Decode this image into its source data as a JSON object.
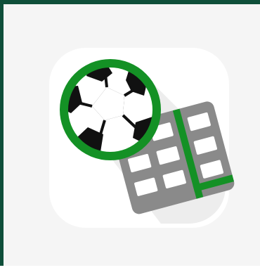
{
  "app_icon": {
    "icon_name": "football-spreadsheet-app-icon",
    "colors": {
      "frame": "#0f4f3a",
      "background": "#f5f5f5",
      "tile": "#ffffff",
      "ring": "#149125",
      "grid": "#8a8a8a",
      "ball_patch": "#111111"
    }
  }
}
